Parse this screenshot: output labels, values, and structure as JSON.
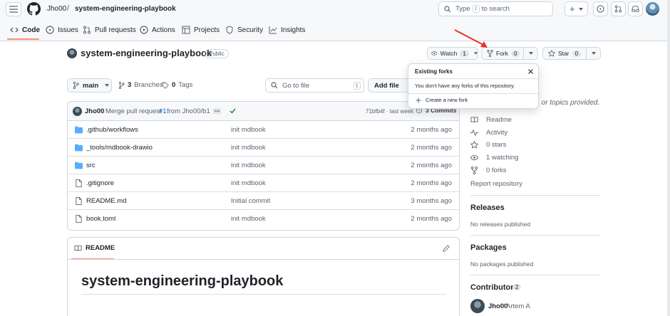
{
  "header": {
    "owner": "Jho00",
    "separator": "/",
    "repo": "system-engineering-playbook",
    "search_type": "Type",
    "search_key": "/",
    "search_rest": "to search",
    "plus": "+"
  },
  "tabs": [
    {
      "label": "Code",
      "icon": "code-icon"
    },
    {
      "label": "Issues",
      "icon": "issue-icon"
    },
    {
      "label": "Pull requests",
      "icon": "pull-request-icon"
    },
    {
      "label": "Actions",
      "icon": "play-icon"
    },
    {
      "label": "Projects",
      "icon": "table-icon"
    },
    {
      "label": "Security",
      "icon": "shield-icon"
    },
    {
      "label": "Insights",
      "icon": "graph-icon"
    }
  ],
  "repo_header": {
    "name": "system-engineering-playbook",
    "visibility": "Public",
    "watch_label": "Watch",
    "watch_count": "1",
    "fork_label": "Fork",
    "fork_count": "0",
    "star_label": "Star",
    "star_count": "0"
  },
  "toolbar": {
    "branch": "main",
    "branches_count": "3",
    "branches_label": "Branches",
    "tags_count": "0",
    "tags_label": "Tags",
    "goto_placeholder": "Go to file",
    "goto_key": "t",
    "add_file": "Add file"
  },
  "commit": {
    "author": "Jho00",
    "message_prefix": "Merge pull request",
    "pr": "#1",
    "message_suffix": "from Jho00/b1",
    "sha_time": "71bfb4f · last week",
    "commits_label": "3 Commits"
  },
  "files": [
    {
      "name": ".github/workflows",
      "type": "folder",
      "message": "init mdbook",
      "date": "2 months ago"
    },
    {
      "name": "_tools/mdbook-drawio",
      "type": "folder",
      "message": "init mdbook",
      "date": "2 months ago"
    },
    {
      "name": "src",
      "type": "folder",
      "message": "init mdbook",
      "date": "2 months ago"
    },
    {
      "name": ".gitignore",
      "type": "file",
      "message": "init mdbook",
      "date": "2 months ago"
    },
    {
      "name": "README.md",
      "type": "file",
      "message": "Initial commit",
      "date": "3 months ago"
    },
    {
      "name": "book.toml",
      "type": "file",
      "message": "init mdbook",
      "date": "2 months ago"
    }
  ],
  "readme": {
    "tab": "README",
    "heading": "system-engineering-playbook"
  },
  "sidebar": {
    "about_fragment": ", or topics provided.",
    "items": [
      {
        "label": "Readme",
        "icon": "book-icon"
      },
      {
        "label": "Activity",
        "icon": "pulse-icon"
      },
      {
        "label": "0 stars",
        "icon": "star-icon"
      },
      {
        "label": "1 watching",
        "icon": "eye-icon"
      },
      {
        "label": "0 forks",
        "icon": "fork-icon"
      }
    ],
    "report": "Report repository",
    "releases_title": "Releases",
    "releases_text": "No releases published",
    "packages_title": "Packages",
    "packages_text": "No packages published",
    "contributors_title": "Contributors",
    "contributors_count": "2",
    "contributor_login": "Jho00",
    "contributor_name": "Artem A"
  },
  "fork_popover": {
    "title": "Existing forks",
    "empty": "You don't have any forks of this repository.",
    "create": "Create a new fork"
  },
  "colors": {
    "accent_tab": "#fd8c73",
    "folder": "#54aeff",
    "arrow": "#e5332a",
    "check": "#1a7f37"
  }
}
